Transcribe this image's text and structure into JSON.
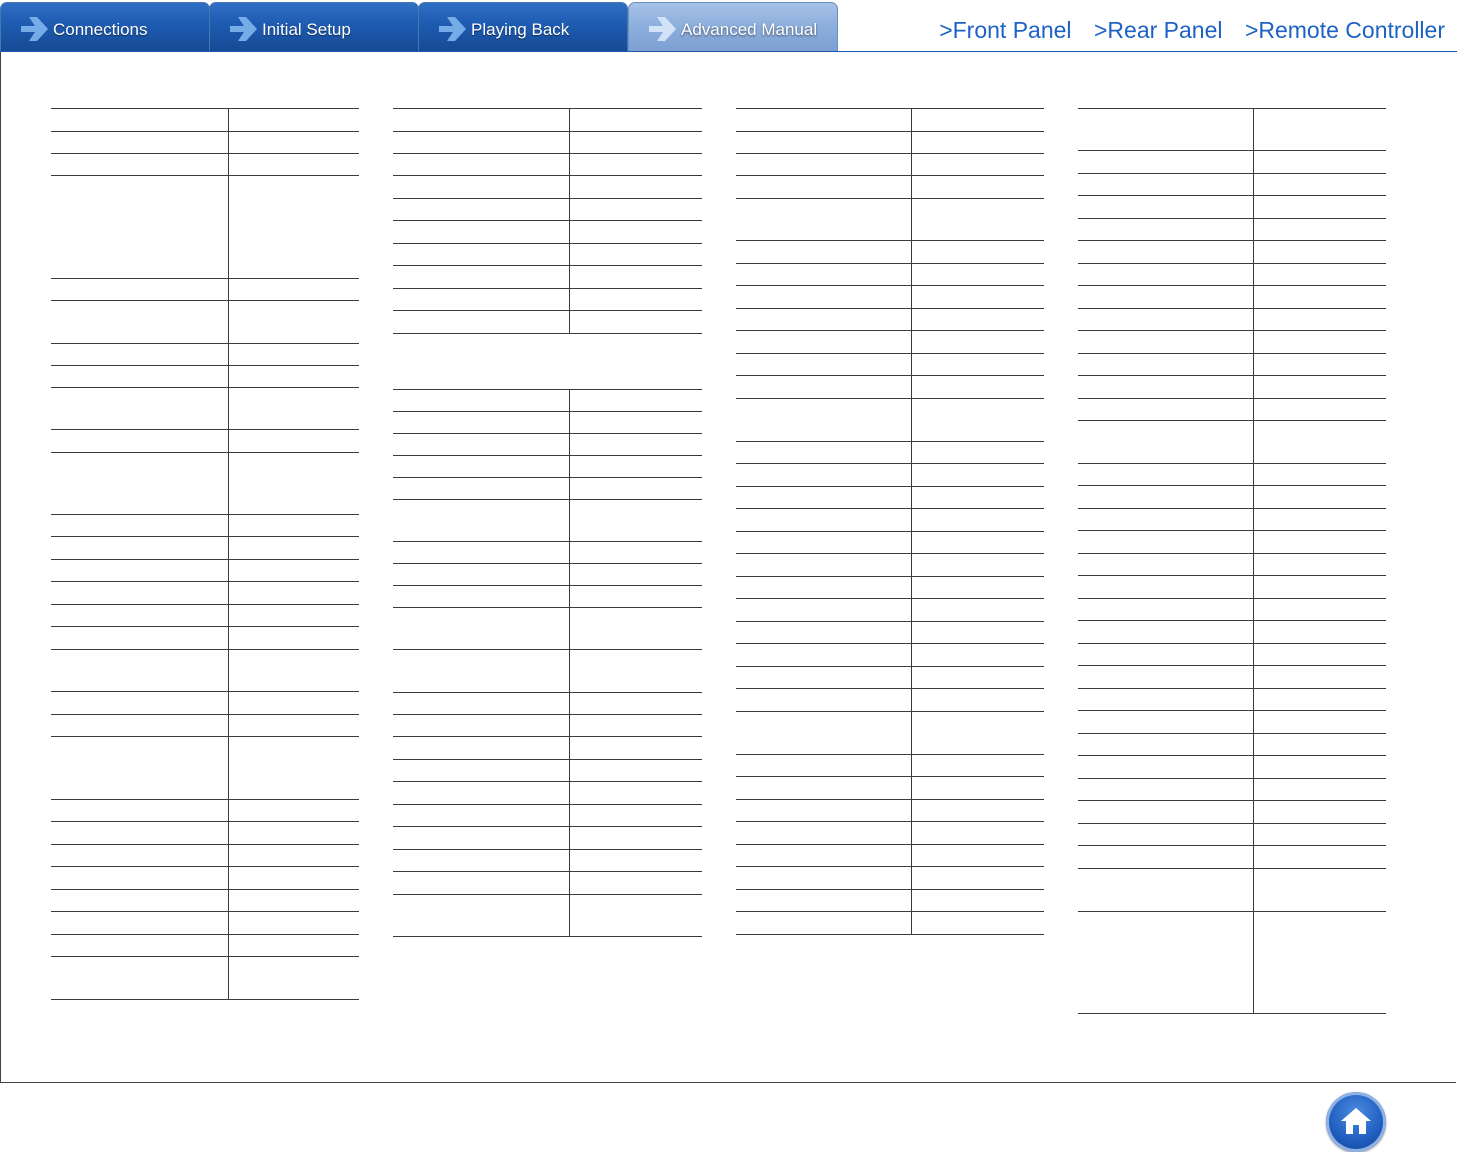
{
  "nav": {
    "tabs": [
      {
        "label": "Connections",
        "active": false
      },
      {
        "label": "Initial Setup",
        "active": false
      },
      {
        "label": "Playing Back",
        "active": false
      },
      {
        "label": "Advanced Manual",
        "active": true
      }
    ],
    "links": {
      "front_panel": ">Front Panel",
      "rear_panel": ">Rear Panel",
      "remote_controller": ">Remote Controller"
    }
  },
  "colors": {
    "tab_blue": "#1e5bb0",
    "tab_active": "#8eb0de",
    "link_blue": "#1d62c4",
    "rule": "#3a3a3a"
  },
  "icons": {
    "tab_arrow": "chevron-right-arrow-icon",
    "home": "home-icon"
  }
}
